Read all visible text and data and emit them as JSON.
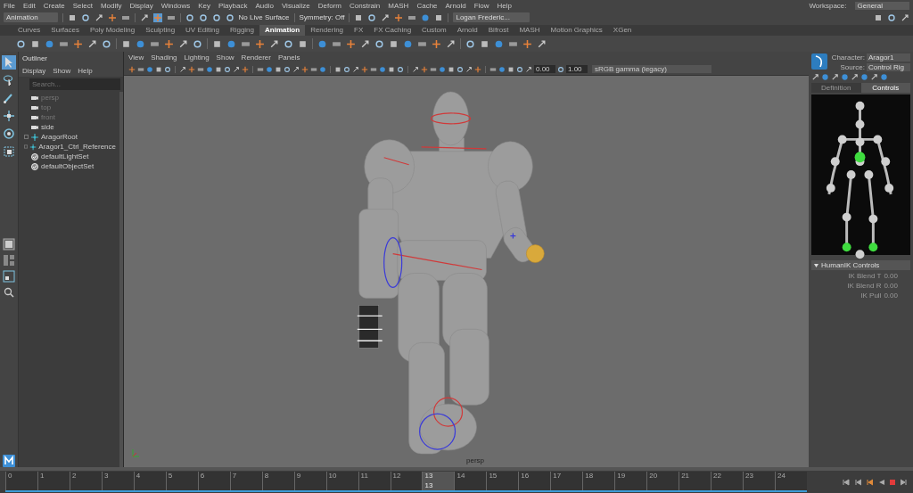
{
  "menu_bar": {
    "items": [
      "File",
      "Edit",
      "Create",
      "Select",
      "Modify",
      "Display",
      "Windows",
      "Key",
      "Playback",
      "Audio",
      "Visualize",
      "Deform",
      "Constrain",
      "MASH",
      "Cache",
      "Arnold",
      "Flow",
      "Help"
    ],
    "workspace_label": "Workspace:",
    "workspace": "General"
  },
  "status_line": {
    "mode": "Animation",
    "live_surface": "No Live Surface",
    "symmetry": "Symmetry: Off",
    "user": "Logan Frederic..."
  },
  "shelf": {
    "tabs": [
      {
        "label": "Curves",
        "selected": false
      },
      {
        "label": "Surfaces",
        "selected": false
      },
      {
        "label": "Poly Modeling",
        "selected": false
      },
      {
        "label": "Sculpting",
        "selected": false
      },
      {
        "label": "UV Editing",
        "selected": false
      },
      {
        "label": "Rigging",
        "selected": false
      },
      {
        "label": "Animation",
        "selected": true
      },
      {
        "label": "Rendering",
        "selected": false
      },
      {
        "label": "FX",
        "selected": false
      },
      {
        "label": "FX Caching",
        "selected": false
      },
      {
        "label": "Custom",
        "selected": false
      },
      {
        "label": "Arnold",
        "selected": false
      },
      {
        "label": "Bifrost",
        "selected": false
      },
      {
        "label": "MASH",
        "selected": false
      },
      {
        "label": "Motion Graphics",
        "selected": false
      },
      {
        "label": "XGen",
        "selected": false
      }
    ]
  },
  "toolbox": [
    {
      "kind": "select",
      "selected": true
    },
    {
      "kind": "lasso",
      "selected": false
    },
    {
      "kind": "paint",
      "selected": false
    },
    {
      "kind": "move",
      "selected": false
    },
    {
      "kind": "rotate",
      "selected": false
    },
    {
      "kind": "scale",
      "selected": false
    }
  ],
  "outliner": {
    "title": "Outliner",
    "menu": [
      "Display",
      "Show",
      "Help"
    ],
    "search": {
      "placeholder": "Search..."
    },
    "items": [
      {
        "label": "persp",
        "kind": "camera",
        "dimmed": true
      },
      {
        "label": "top",
        "kind": "camera",
        "dimmed": true
      },
      {
        "label": "front",
        "kind": "camera",
        "dimmed": true
      },
      {
        "label": "side",
        "kind": "camera",
        "dimmed": false
      },
      {
        "label": "AragorRoot",
        "kind": "joint",
        "dimmed": false
      },
      {
        "label": "Aragor1_Ctrl_Reference",
        "kind": "joint",
        "dimmed": false
      },
      {
        "label": "defaultLightSet",
        "kind": "set",
        "dimmed": false
      },
      {
        "label": "defaultObjectSet",
        "kind": "set",
        "dimmed": false
      }
    ]
  },
  "viewport": {
    "menu": [
      "View",
      "Shading",
      "Lighting",
      "Show",
      "Renderer",
      "Panels"
    ],
    "exposure": "0.00",
    "gamma": "1.00",
    "color_space": "sRGB gamma (legacy)",
    "camera": "persp"
  },
  "character_controls": {
    "character_label": "Character:",
    "character": "Aragor1",
    "source_label": "Source:",
    "source": "Control Rig",
    "tabs": [
      {
        "label": "Definition",
        "selected": false
      },
      {
        "label": "Controls",
        "selected": true
      }
    ],
    "section": "HumanIK Controls",
    "attributes": [
      {
        "label": "IK Blend T",
        "value": "0.00"
      },
      {
        "label": "IK Blend R",
        "value": "0.00"
      },
      {
        "label": "IK Pull",
        "value": "0.00"
      }
    ]
  },
  "timeline": {
    "frames": [
      {
        "label": "0",
        "selected": false
      },
      {
        "label": "1",
        "selected": false
      },
      {
        "label": "2",
        "selected": false
      },
      {
        "label": "3",
        "selected": false
      },
      {
        "label": "4",
        "selected": false
      },
      {
        "label": "5",
        "selected": false
      },
      {
        "label": "6",
        "selected": false
      },
      {
        "label": "7",
        "selected": false
      },
      {
        "label": "8",
        "selected": false
      },
      {
        "label": "9",
        "selected": false
      },
      {
        "label": "10",
        "selected": false
      },
      {
        "label": "11",
        "selected": false
      },
      {
        "label": "12",
        "selected": false
      },
      {
        "label": "13",
        "selected": true
      },
      {
        "label": "14",
        "selected": false
      },
      {
        "label": "15",
        "selected": false
      },
      {
        "label": "16",
        "selected": false
      },
      {
        "label": "17",
        "selected": false
      },
      {
        "label": "18",
        "selected": false
      },
      {
        "label": "19",
        "selected": false
      },
      {
        "label": "20",
        "selected": false
      },
      {
        "label": "21",
        "selected": false
      },
      {
        "label": "22",
        "selected": false
      },
      {
        "label": "23",
        "selected": false
      },
      {
        "label": "24",
        "selected": false
      }
    ],
    "current": "13"
  }
}
